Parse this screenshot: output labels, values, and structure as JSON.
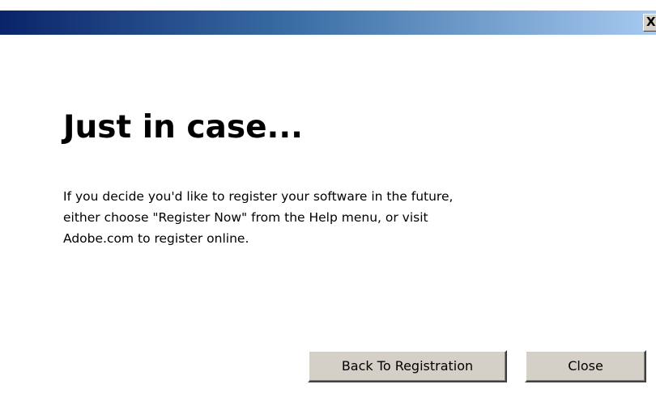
{
  "titlebar": {
    "close_glyph": "X"
  },
  "dialog": {
    "heading": "Just in case...",
    "message_lines": [
      "If you decide you'd like to register your software in the future,",
      "either choose \"Register Now\" from the Help menu, or visit",
      "Adobe.com to register online."
    ]
  },
  "buttons": {
    "back_label": "Back To Registration",
    "close_label": "Close"
  },
  "colors": {
    "titlebar_start": "#0a246a",
    "titlebar_end": "#a6caf0",
    "button_face": "#d4d0c8",
    "background": "#ffffff"
  }
}
